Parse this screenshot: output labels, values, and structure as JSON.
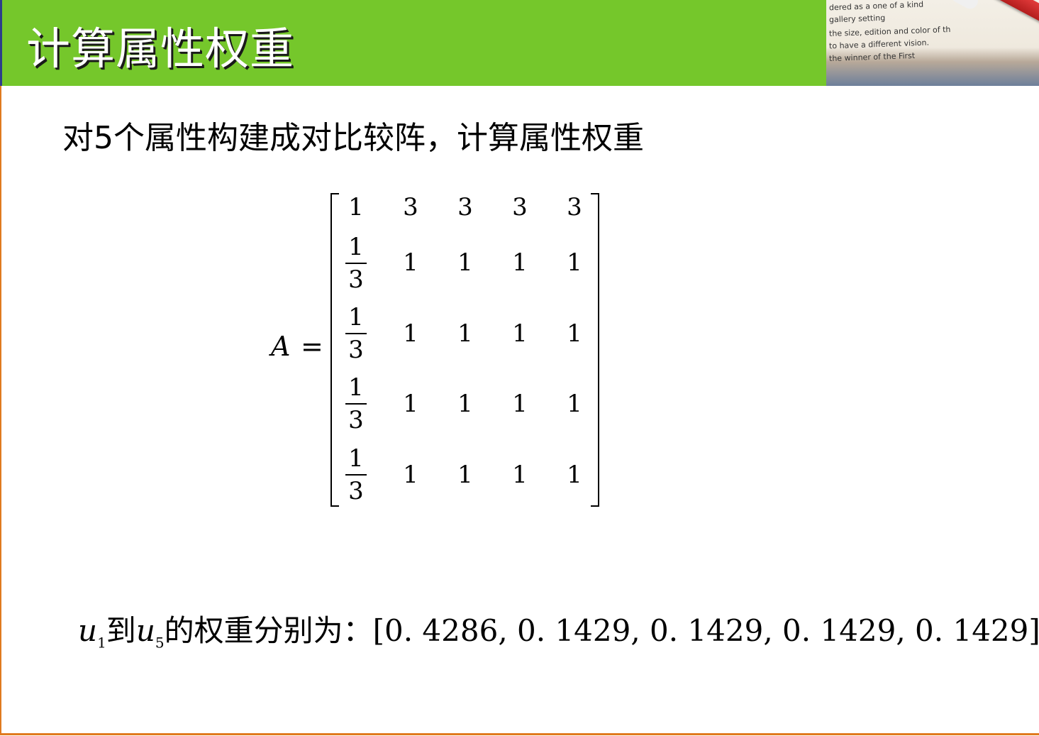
{
  "title": "计算属性权重",
  "subtitle": "对5个属性构建成对比较阵，计算属性权重",
  "corner_image_text": [
    "dered as a one of a kind",
    "gallery setting",
    "the size, edition and color of th",
    "to have a different vision.",
    "the winner of the First"
  ],
  "matrix": {
    "label": "A",
    "equals": "=",
    "row1": [
      "1",
      "3",
      "3",
      "3",
      "3"
    ],
    "fraction": {
      "numerator": "1",
      "denominator": "3"
    },
    "rows_tail": [
      [
        "1",
        "1",
        "1",
        "1"
      ],
      [
        "1",
        "1",
        "1",
        "1"
      ],
      [
        "1",
        "1",
        "1",
        "1"
      ],
      [
        "1",
        "1",
        "1",
        "1"
      ]
    ]
  },
  "result": {
    "var": "u",
    "sub_start": "1",
    "to_text": "到",
    "sub_end": "5",
    "label": "的权重分别为：",
    "values": "[0. 4286, 0. 1429, 0. 1429, 0. 1429, 0. 1429]"
  },
  "colors": {
    "header_green": "#75c72b",
    "accent_orange": "#e07a1f",
    "title_text": "#ffffff"
  }
}
